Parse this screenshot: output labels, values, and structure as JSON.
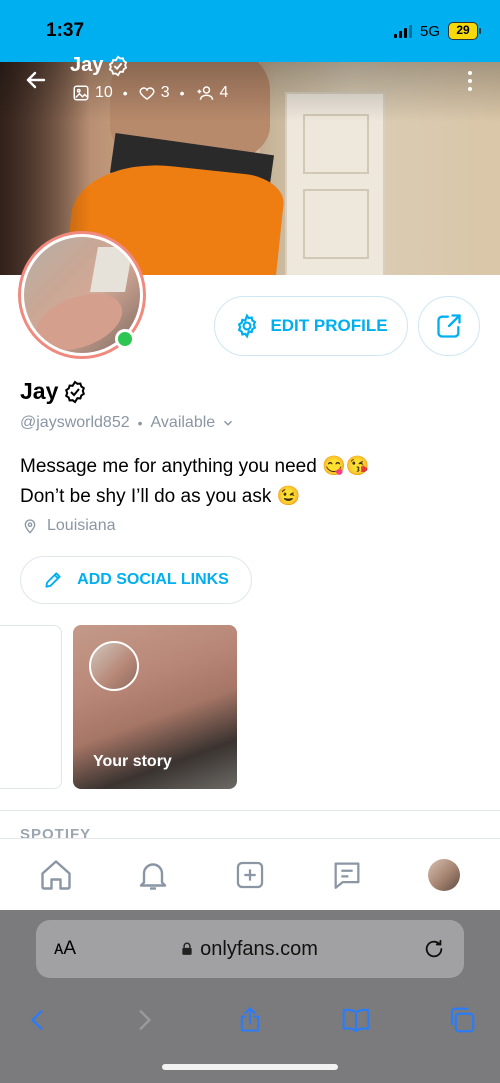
{
  "status": {
    "time": "1:37",
    "network": "5G",
    "battery": "29"
  },
  "cover": {
    "name": "Jay",
    "stats": {
      "posts": "10",
      "likes": "3",
      "fans": "4"
    }
  },
  "profile": {
    "name": "Jay",
    "handle": "@jaysworld852",
    "availability": "Available",
    "bio_line1": "Message me for anything you need 😋😘",
    "bio_line2": "Don’t be shy I’ll do as you ask 😉",
    "location": "Louisiana"
  },
  "buttons": {
    "edit_profile": "EDIT PROFILE",
    "add_social_links": "ADD SOCIAL LINKS"
  },
  "stories": {
    "your_story_label": "Your story"
  },
  "sections": {
    "spotify": "SPOTIFY"
  },
  "browser": {
    "text_size_label": "ᴀA",
    "url": "onlyfans.com"
  },
  "colors": {
    "accent": "#00aff0",
    "online": "#2dc653",
    "avatar_ring": "#f08a7f"
  },
  "icons": [
    "back-arrow-icon",
    "verified-icon",
    "image-icon",
    "heart-icon",
    "fans-icon",
    "more-vertical-icon",
    "gear-icon",
    "share-icon",
    "chevron-down-icon",
    "location-pin-icon",
    "pencil-icon",
    "home-icon",
    "bell-icon",
    "plus-square-icon",
    "message-icon",
    "lock-icon",
    "reload-icon",
    "chevron-left-icon",
    "chevron-right-icon",
    "share-upload-icon",
    "book-icon",
    "tabs-icon"
  ]
}
